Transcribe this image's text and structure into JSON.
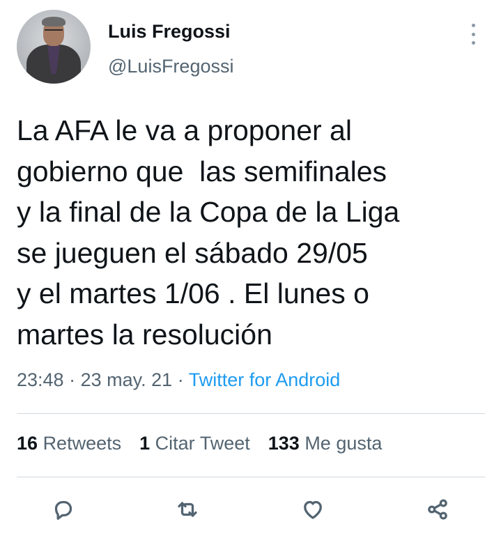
{
  "author": {
    "name": "Luis Fregossi",
    "handle": "@LuisFregossi",
    "avatar_icon": "profile-photo"
  },
  "menu_icon": "more-vertical-icon",
  "tweet": {
    "text": "La AFA le va a proponer al\ngobierno que  las semifinales\ny la final de la Copa de la Liga\nse jueguen el sábado 29/05\ny el martes 1/06 . El lunes o\nmartes la resolución",
    "time": "23:48",
    "date": "23 may. 21",
    "separator": "·",
    "source": "Twitter for Android"
  },
  "stats": {
    "retweets_count": "16",
    "retweets_label": "Retweets",
    "quotes_count": "1",
    "quotes_label": "Citar Tweet",
    "likes_count": "133",
    "likes_label": "Me gusta"
  },
  "actions": [
    "reply-icon",
    "retweet-icon",
    "like-icon",
    "share-icon"
  ],
  "colors": {
    "text": "#0f1419",
    "secondary": "#536471",
    "link": "#1d9bf0",
    "divider": "#cfd9de"
  }
}
